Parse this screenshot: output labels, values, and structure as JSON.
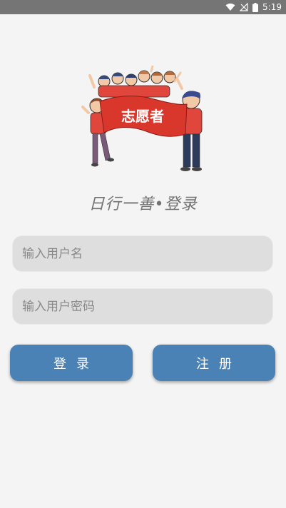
{
  "status_bar": {
    "time": "5:19",
    "icons": [
      "wifi-icon",
      "no-signal-icon",
      "battery-icon"
    ]
  },
  "hero": {
    "banner_text": "志愿者",
    "banner_color": "#d9362c"
  },
  "subtitle": "日行一善•登录",
  "form": {
    "username_placeholder": "输入用户名",
    "password_placeholder": "输入用户密码"
  },
  "buttons": {
    "login_label": "登录",
    "register_label": "注册"
  },
  "colors": {
    "button": "#4a82b6",
    "field": "#dedede",
    "background": "#f4f4f4",
    "status_bar": "#757575"
  }
}
